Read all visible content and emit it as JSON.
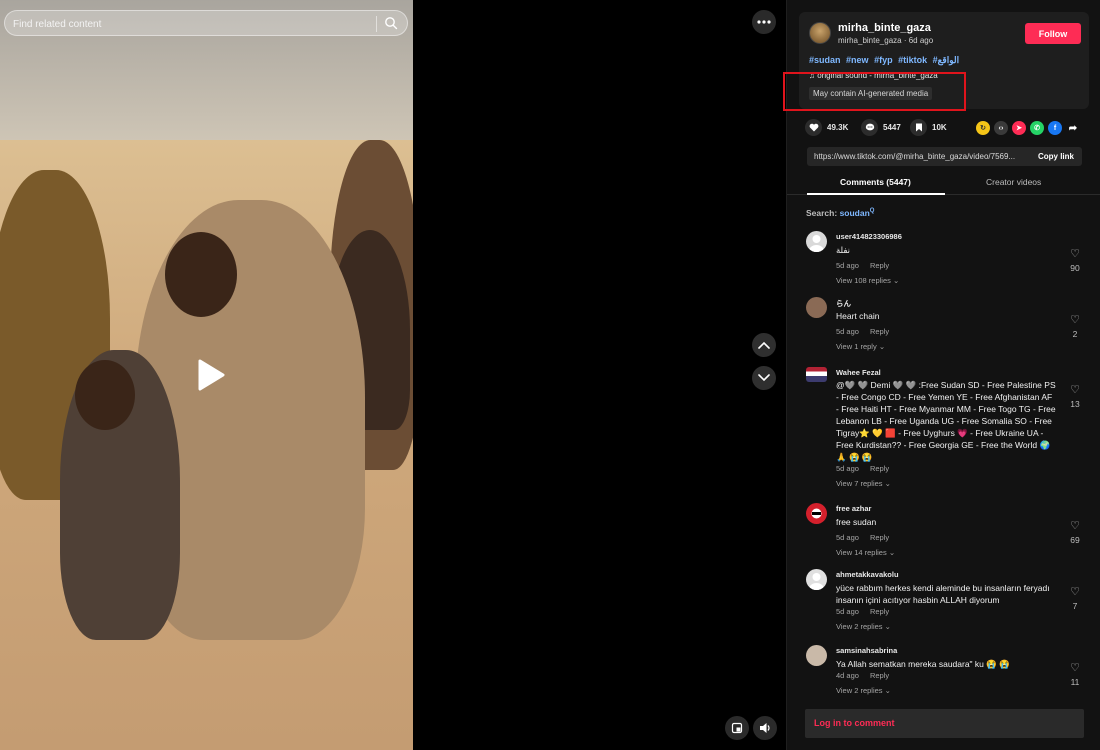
{
  "video": {
    "search_placeholder": "Find related content"
  },
  "post": {
    "username": "mirha_binte_gaza",
    "handle_line": "mirha_binte_gaza · 6d ago",
    "follow_label": "Follow",
    "hashtags": [
      "#sudan",
      "#new",
      "#fyp",
      "#tiktok",
      "#الواقع"
    ],
    "sound": "original sound - mirha_binte_gaza",
    "ai_label": "May contain AI-generated media"
  },
  "stats": {
    "likes": "49.3K",
    "comments": "5447",
    "saves": "10K"
  },
  "link": {
    "url": "https://www.tiktok.com/@mirha_binte_gaza/video/7569...",
    "copy_label": "Copy link"
  },
  "tabs": {
    "comments": "Comments (5447)",
    "creator_videos": "Creator videos"
  },
  "search": {
    "label": "Search:",
    "keyword": "soudan"
  },
  "comments": [
    {
      "user": "user414823306986",
      "text": "نفلة",
      "time": "5d ago",
      "reply": "Reply",
      "replies": "View 108 replies",
      "likes": "90"
    },
    {
      "user": "らん",
      "text": "Heart chain",
      "time": "5d ago",
      "reply": "Reply",
      "replies": "View 1 reply",
      "likes": "2"
    },
    {
      "user": "Wahee Fezal",
      "text": "@🩶 🩶 Demi 🩶 🩶 :Free Sudan SD - Free Palestine PS - Free Congo CD - Free Yemen YE - Free Afghanistan AF - Free Haiti HT - Free Myanmar MM - Free Togo TG - Free Lebanon LB - Free Uganda UG - Free Somalia SO - Free Tigray⭐ 💛 🟥 - Free Uyghurs 💗 - Free Ukraine UA - Free Kurdistan?? - Free Georgia GE - Free the World 🌍 🙏 😭 😭",
      "time": "5d ago",
      "reply": "Reply",
      "replies": "View 7 replies",
      "likes": "13"
    },
    {
      "user": "free azhar",
      "text": "free sudan",
      "time": "5d ago",
      "reply": "Reply",
      "replies": "View 14 replies",
      "likes": "69"
    },
    {
      "user": "ahmetakkavakolu",
      "text": "yüce rabbım herkes kendi aleminde bu insanların feryadı insanın içini acıtıyor hasbin ALLAH diyorum",
      "time": "5d ago",
      "reply": "Reply",
      "replies": "View 2 replies",
      "likes": "7"
    },
    {
      "user": "samsinahsabrina",
      "text": "Ya Allah sematkan mereka saudara\" ku 😭 😭",
      "time": "4d ago",
      "reply": "Reply",
      "replies": "View 2 replies",
      "likes": "11"
    }
  ],
  "login": {
    "label": "Log in to comment"
  },
  "colors": {
    "accent": "#fe2c55",
    "hashtag": "#7fb8ff",
    "panel_bg": "#121212",
    "highlight": "#e0141c"
  }
}
